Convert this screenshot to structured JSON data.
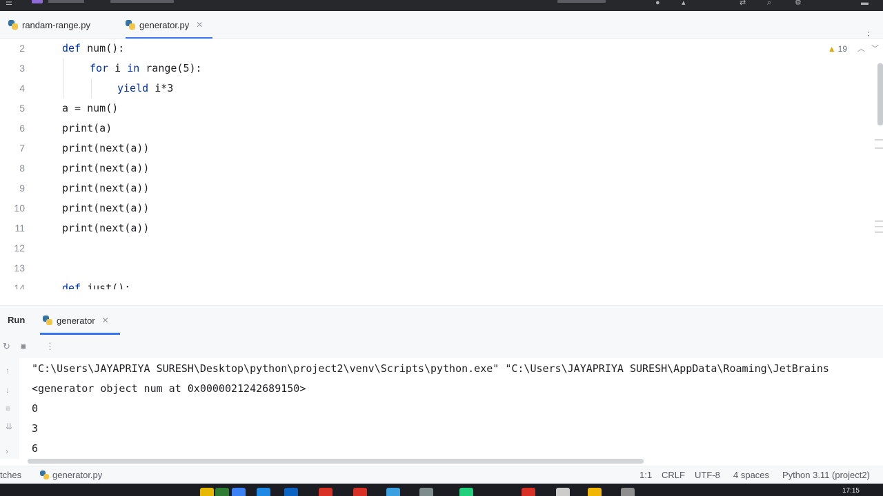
{
  "editor_tabs": [
    {
      "label": "randam-range.py",
      "active": false
    },
    {
      "label": "generator.py",
      "active": true
    }
  ],
  "editor": {
    "inspection_count": "19",
    "lines": [
      {
        "num": "2",
        "indent": 0,
        "tokens": [
          {
            "t": "def ",
            "k": "kw"
          },
          {
            "t": "num():",
            "k": ""
          }
        ]
      },
      {
        "num": "3",
        "indent": 1,
        "tokens": [
          {
            "t": "for ",
            "k": "kw"
          },
          {
            "t": "i ",
            "k": ""
          },
          {
            "t": "in ",
            "k": "kw"
          },
          {
            "t": "range(5):",
            "k": ""
          }
        ]
      },
      {
        "num": "4",
        "indent": 2,
        "tokens": [
          {
            "t": "yield ",
            "k": "kw"
          },
          {
            "t": "i*3",
            "k": ""
          }
        ]
      },
      {
        "num": "5",
        "indent": 0,
        "tokens": [
          {
            "t": "a = num()",
            "k": ""
          }
        ]
      },
      {
        "num": "6",
        "indent": 0,
        "tokens": [
          {
            "t": "print(a)",
            "k": ""
          }
        ]
      },
      {
        "num": "7",
        "indent": 0,
        "tokens": [
          {
            "t": "print(next(a))",
            "k": ""
          }
        ]
      },
      {
        "num": "8",
        "indent": 0,
        "tokens": [
          {
            "t": "print(next(a))",
            "k": ""
          }
        ]
      },
      {
        "num": "9",
        "indent": 0,
        "tokens": [
          {
            "t": "print(next(a))",
            "k": ""
          }
        ]
      },
      {
        "num": "10",
        "indent": 0,
        "tokens": [
          {
            "t": "print(next(a))",
            "k": ""
          }
        ]
      },
      {
        "num": "11",
        "indent": 0,
        "tokens": [
          {
            "t": "print(next(a))",
            "k": ""
          }
        ]
      },
      {
        "num": "12",
        "indent": 0,
        "tokens": []
      },
      {
        "num": "13",
        "indent": 0,
        "tokens": []
      },
      {
        "num": "14",
        "indent": 0,
        "tokens": [
          {
            "t": "def ",
            "k": "kw"
          },
          {
            "t": "just():",
            "k": ""
          }
        ]
      }
    ]
  },
  "run": {
    "label": "Run",
    "tab_label": "generator",
    "output": [
      "\"C:\\Users\\JAYAPRIYA SURESH\\Desktop\\python\\project2\\venv\\Scripts\\python.exe\" \"C:\\Users\\JAYAPRIYA SURESH\\AppData\\Roaming\\JetBrains",
      "<generator object num at 0x0000021242689150>",
      "0",
      "3",
      "6"
    ]
  },
  "status": {
    "left": "tches",
    "file": "generator.py",
    "position": "1:1",
    "line_sep": "CRLF",
    "encoding": "UTF-8",
    "indent": "4 spaces",
    "interpreter": "Python 3.11 (project2)"
  },
  "taskbar": {
    "clock": "17:15",
    "icon_colors": [
      "#e6b800",
      "#2e7d32",
      "#3b82f6",
      "#1e88e5",
      "#0b63c4",
      "#d93025",
      "#d93025",
      "#3aa0e0",
      "#7f8c8d",
      "#21d07a",
      "#d93025",
      "#cccccc",
      "#f2b705",
      "#8e8e8e"
    ]
  },
  "colors": {
    "accent": "#3574f0",
    "keyword": "#0033b3"
  }
}
